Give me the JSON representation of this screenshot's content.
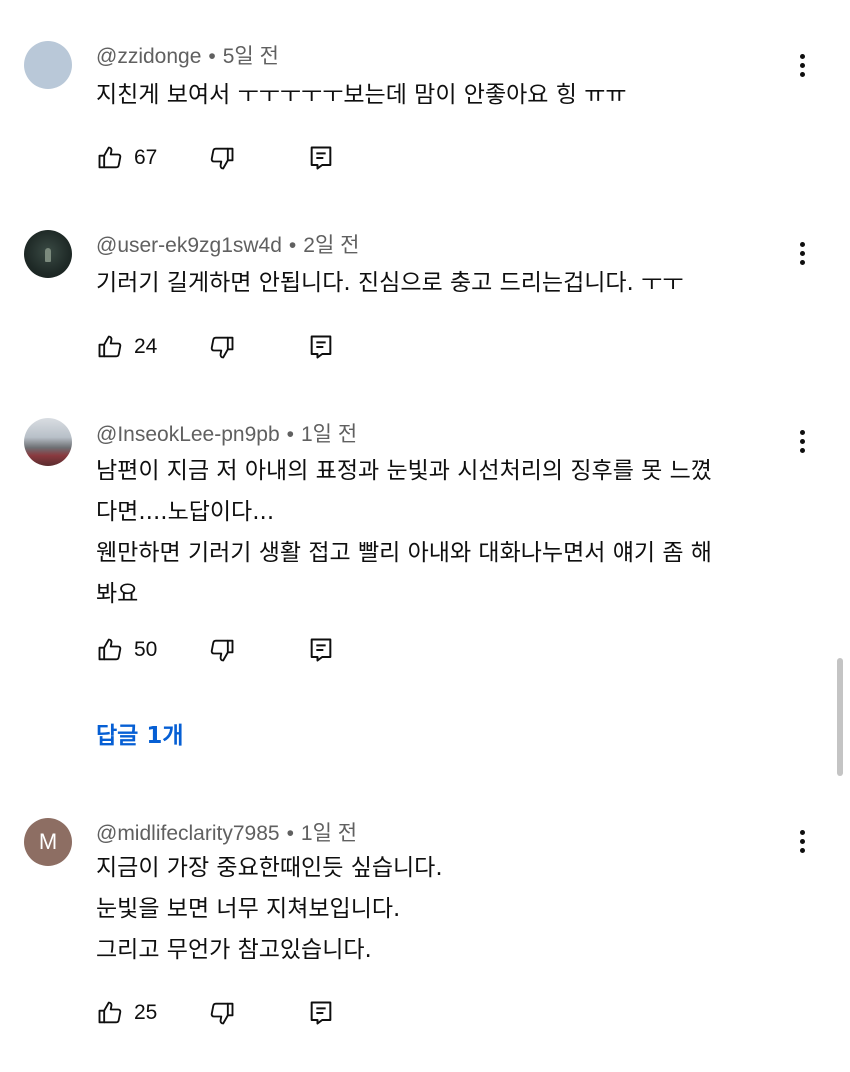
{
  "comments": [
    {
      "author": "@zzidonge",
      "time": "5일 전",
      "lines": [
        "지친게 보여서 ㅜㅜㅜㅜㅜ보는데 맘이 안좋아요 힝 ㅠㅠ"
      ],
      "likes": "67",
      "avatar": "avatar-blank"
    },
    {
      "author": "@user-ek9zg1sw4d",
      "time": "2일 전",
      "lines": [
        "기러기 길게하면 안됩니다. 진심으로 충고 드리는겁니다. ㅜㅜ"
      ],
      "likes": "24",
      "avatar": "avatar-dark"
    },
    {
      "author": "@InseokLee-pn9pb",
      "time": "1일 전",
      "lines": [
        "남편이 지금 저 아내의 표정과 눈빛과 시선처리의 징후를 못 느꼈",
        "다면....노답이다...",
        "웬만하면 기러기 생활 접고 빨리 아내와 대화나누면서 얘기 좀 해",
        "봐요"
      ],
      "likes": "50",
      "avatar": "avatar-photo",
      "replies_label": "답글 1개"
    },
    {
      "author": "@midlifeclarity7985",
      "time": "1일 전",
      "lines": [
        "지금이 가장 중요한때인듯 싶습니다.",
        "눈빛을 보면 너무 지쳐보입니다.",
        "그리고 무언가 참고있습니다."
      ],
      "likes": "25",
      "avatar": "avatar-letter",
      "avatar_letter": "M"
    }
  ],
  "separator": "•",
  "colors": {
    "text": "#0f0f0f",
    "meta": "#606060",
    "link": "#065fd4",
    "letter_avatar": "#8d6e63"
  },
  "icons": {
    "like": "thumbs-up-icon",
    "dislike": "thumbs-down-icon",
    "reply": "reply-comment-icon",
    "more": "more-vertical-icon"
  }
}
